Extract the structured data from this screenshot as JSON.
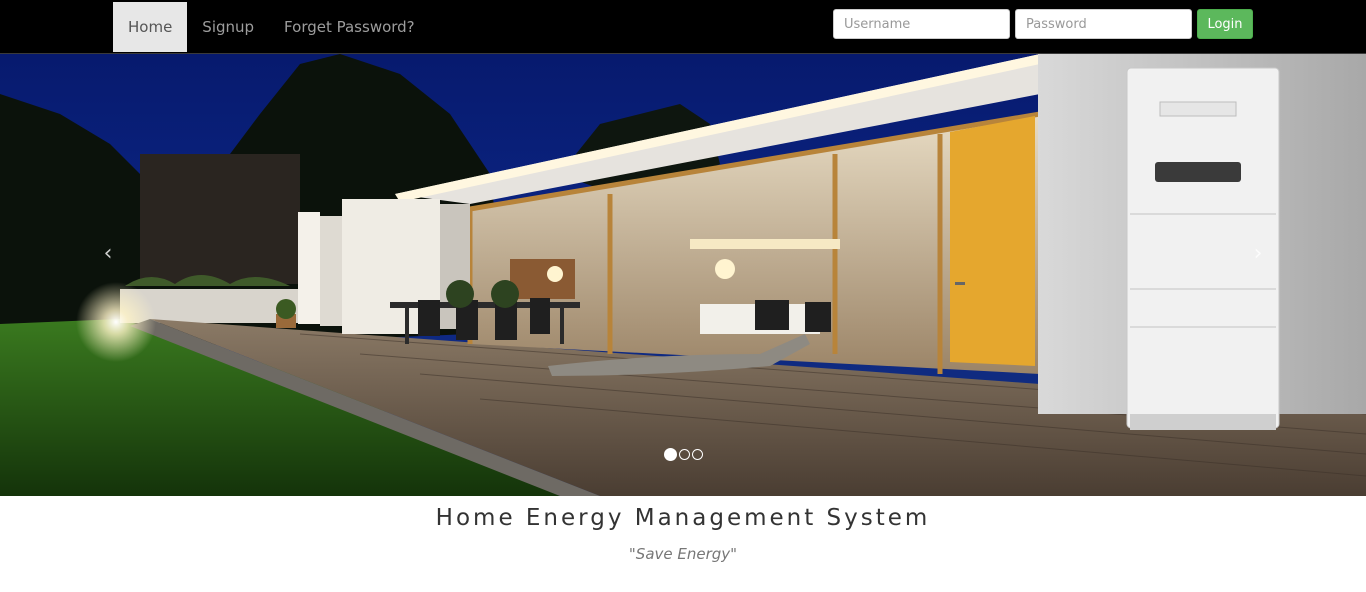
{
  "nav": {
    "items": [
      {
        "label": "Home",
        "active": true
      },
      {
        "label": "Signup",
        "active": false
      },
      {
        "label": "Forget Password?",
        "active": false
      }
    ]
  },
  "login": {
    "username_placeholder": "Username",
    "password_placeholder": "Password",
    "button_label": "Login"
  },
  "carousel": {
    "prev_glyph": "‹",
    "next_glyph": "›",
    "slide_count": 3,
    "active_slide": 1
  },
  "main": {
    "title": "Home Energy Management System",
    "tagline": "\"Save Energy\""
  },
  "colors": {
    "navbar_bg": "#000000",
    "login_button": "#5cb85c",
    "active_nav_bg": "#e7e7e7"
  }
}
